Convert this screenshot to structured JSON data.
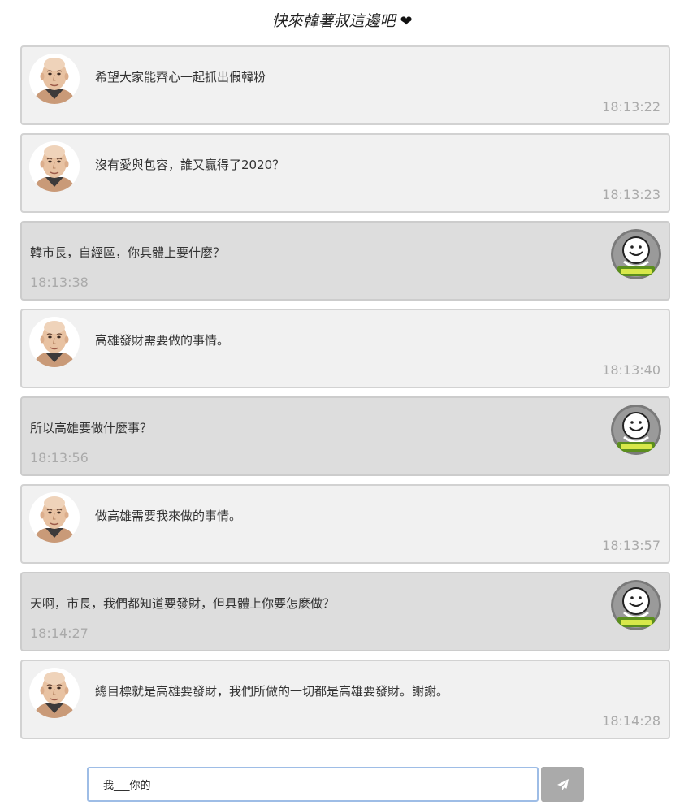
{
  "header": {
    "title": "快來韓薯叔這邊吧",
    "heart_icon": "heart-icon",
    "heart_glyph": "❤"
  },
  "colors": {
    "bot_bubble": "#f1f1f1",
    "user_bubble": "#dddddd",
    "timestamp": "#aaaaaa",
    "send_button": "#aaaaaa",
    "input_border": "#9ebde6"
  },
  "messages": [
    {
      "side": "left",
      "avatar": "mayor-avatar",
      "text": "希望大家能齊心一起抓出假韓粉",
      "time": "18:13:22"
    },
    {
      "side": "left",
      "avatar": "mayor-avatar",
      "text": "沒有愛與包容，誰又贏得了2020？",
      "time": "18:13:23"
    },
    {
      "side": "right",
      "avatar": "smiley-avatar",
      "text": "韓市長，自經區，你具體上要什麼？",
      "time": "18:13:38"
    },
    {
      "side": "left",
      "avatar": "mayor-avatar",
      "text": "高雄發財需要做的事情。",
      "time": "18:13:40"
    },
    {
      "side": "right",
      "avatar": "smiley-avatar",
      "text": "所以高雄要做什麼事？",
      "time": "18:13:56"
    },
    {
      "side": "left",
      "avatar": "mayor-avatar",
      "text": "做高雄需要我來做的事情。",
      "time": "18:13:57"
    },
    {
      "side": "right",
      "avatar": "smiley-avatar",
      "text": "天啊，市長，我們都知道要發財，但具體上你要怎麼做？",
      "time": "18:14:27"
    },
    {
      "side": "left",
      "avatar": "mayor-avatar",
      "text": "總目標就是高雄要發財，我們所做的一切都是高雄要發財。謝謝。",
      "time": "18:14:28"
    }
  ],
  "composer": {
    "input_value": "我___你的",
    "send_icon": "paper-plane-icon"
  }
}
